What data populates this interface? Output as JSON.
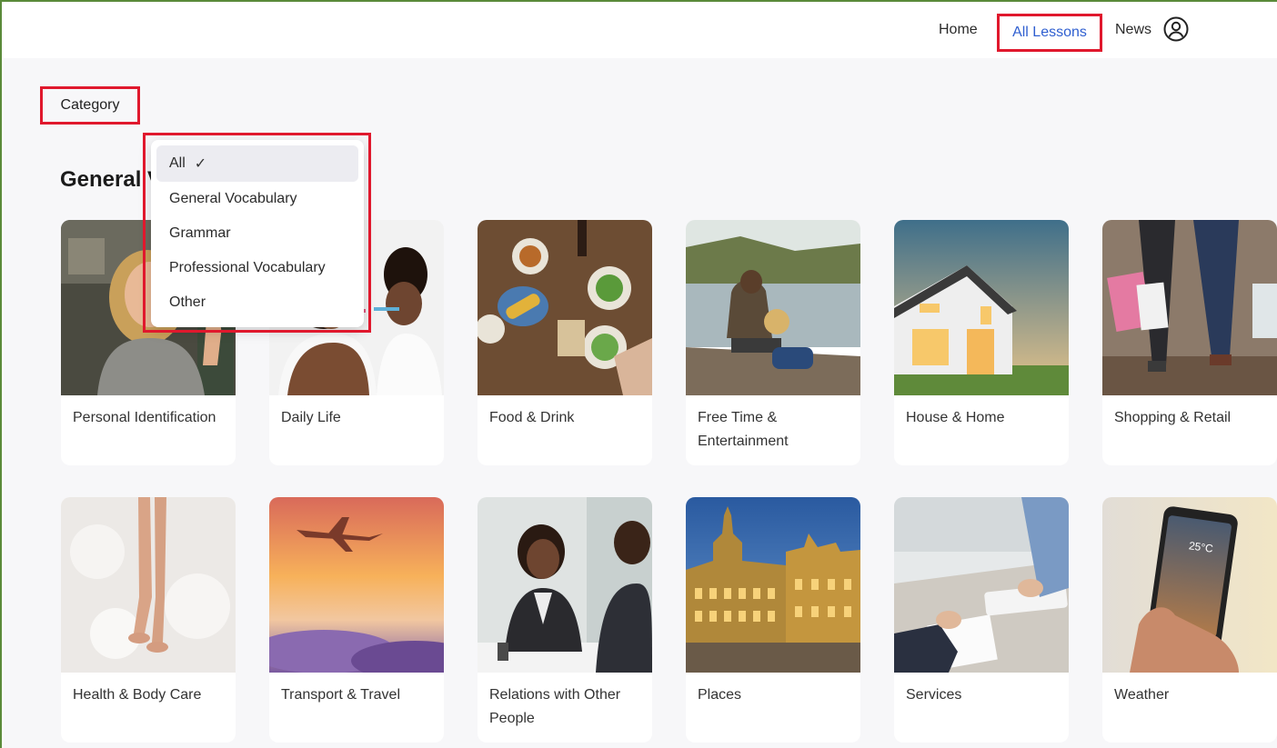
{
  "nav": {
    "home": "Home",
    "all_lessons": "All Lessons",
    "news": "News",
    "user_icon": "user-circle-icon",
    "active_color": "#2f5fd0"
  },
  "filter": {
    "label": "Category",
    "options": [
      "All",
      "General Vocabulary",
      "Grammar",
      "Professional Vocabulary",
      "Other"
    ],
    "selected": "All",
    "check_glyph": "✓"
  },
  "section": {
    "title": "General Vocabulary"
  },
  "cards": [
    {
      "label": "Personal Identification",
      "image": "woman-waving"
    },
    {
      "label": "Daily Life",
      "image": "brushing-teeth"
    },
    {
      "label": "Food & Drink",
      "image": "food-table"
    },
    {
      "label": "Free Time & Entertainment",
      "image": "man-by-lake"
    },
    {
      "label": "House & Home",
      "image": "house-at-dusk"
    },
    {
      "label": "Shopping & Retail",
      "image": "shopping-bags"
    },
    {
      "label": "Health & Body Care",
      "image": "bath-foam"
    },
    {
      "label": "Transport & Travel",
      "image": "plane-sunset"
    },
    {
      "label": "Relations with Other People",
      "image": "business-meeting"
    },
    {
      "label": "Places",
      "image": "grand-place"
    },
    {
      "label": "Services",
      "image": "office-desk"
    },
    {
      "label": "Weather",
      "image": "weather-phone"
    }
  ],
  "weather_phone": {
    "temperature": "25°C"
  },
  "highlight_color": "#e0182d"
}
